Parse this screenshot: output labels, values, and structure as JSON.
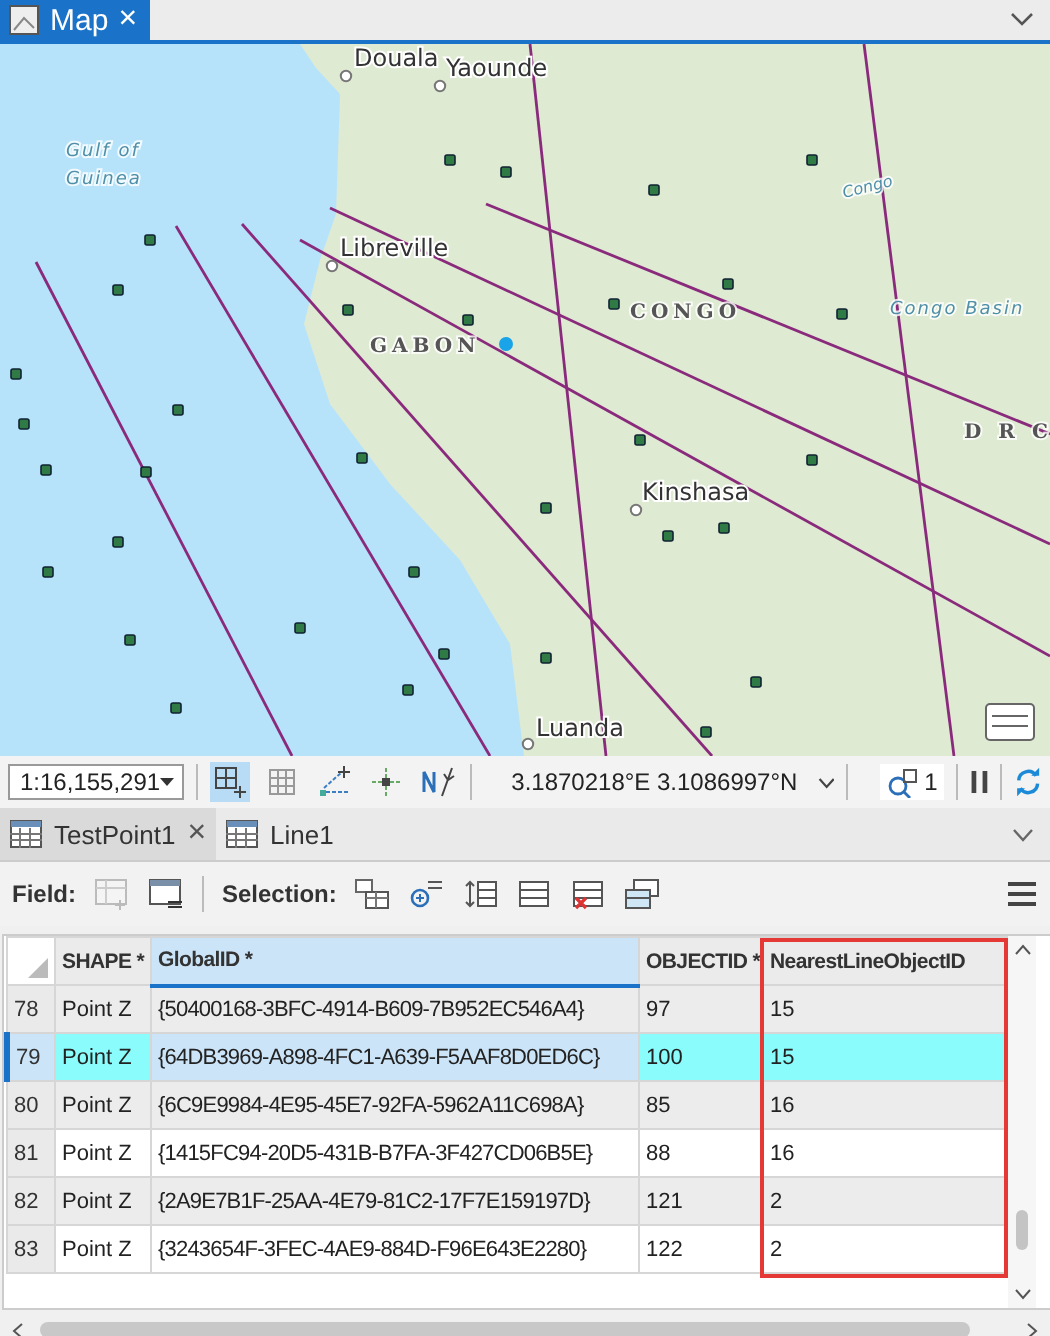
{
  "map_tab": {
    "label": "Map",
    "selected": true,
    "close": "×"
  },
  "map": {
    "labels": [
      {
        "text": "Douala",
        "kind": "city"
      },
      {
        "text": "Yaounde",
        "kind": "city"
      },
      {
        "text": "Gulf of",
        "kind": "water"
      },
      {
        "text": "Guinea",
        "kind": "water"
      },
      {
        "text": "Libreville",
        "kind": "city"
      },
      {
        "text": "Congo",
        "kind": "river"
      },
      {
        "text": "CONGO",
        "kind": "country"
      },
      {
        "text": "Congo Basin",
        "kind": "water"
      },
      {
        "text": "GABON",
        "kind": "country"
      },
      {
        "text": "D R C",
        "kind": "country"
      },
      {
        "text": "Kinshasa",
        "kind": "city"
      },
      {
        "text": "Luanda",
        "kind": "city"
      }
    ]
  },
  "map_toolbar": {
    "scale": "1:16,155,291",
    "coordinates": "3.1870218°E 3.1086997°N",
    "selection_count": "1"
  },
  "table_tabs": [
    {
      "label": "TestPoint1",
      "selected": true,
      "close": "×"
    },
    {
      "label": "Line1",
      "selected": false
    }
  ],
  "table_toolbar": {
    "field_label": "Field:",
    "selection_label": "Selection:"
  },
  "table": {
    "columns": [
      {
        "label": "SHAPE *",
        "selected": false,
        "highlighted": false
      },
      {
        "label": "GlobalID *",
        "selected": true,
        "highlighted": false
      },
      {
        "label": "OBJECTID *",
        "selected": false,
        "highlighted": false
      },
      {
        "label": "NearestLineObjectID",
        "selected": false,
        "highlighted": true
      }
    ],
    "rows": [
      {
        "number": "78",
        "selected": false,
        "cells": [
          "Point Z",
          "{50400168-3BFC-4914-B609-7B952EC546A4}",
          "97",
          "15"
        ]
      },
      {
        "number": "79",
        "selected": true,
        "cells": [
          "Point Z",
          "{64DB3969-A898-4FC1-A639-F5AAF8D0ED6C}",
          "100",
          "15"
        ]
      },
      {
        "number": "80",
        "selected": false,
        "cells": [
          "Point Z",
          "{6C9E9984-4E95-45E7-92FA-5962A11C698A}",
          "85",
          "16"
        ]
      },
      {
        "number": "81",
        "selected": false,
        "cells": [
          "Point Z",
          "{1415FC94-20D5-431B-B7FA-3F427CD06B5E}",
          "88",
          "16"
        ]
      },
      {
        "number": "82",
        "selected": false,
        "cells": [
          "Point Z",
          "{2A9E7B1F-25AA-4E79-81C2-17F7E159197D}",
          "121",
          "2"
        ]
      },
      {
        "number": "83",
        "selected": false,
        "cells": [
          "Point Z",
          "{3243654F-3FEC-4AE9-884D-F96E643E2280}",
          "122",
          "2"
        ]
      }
    ]
  }
}
